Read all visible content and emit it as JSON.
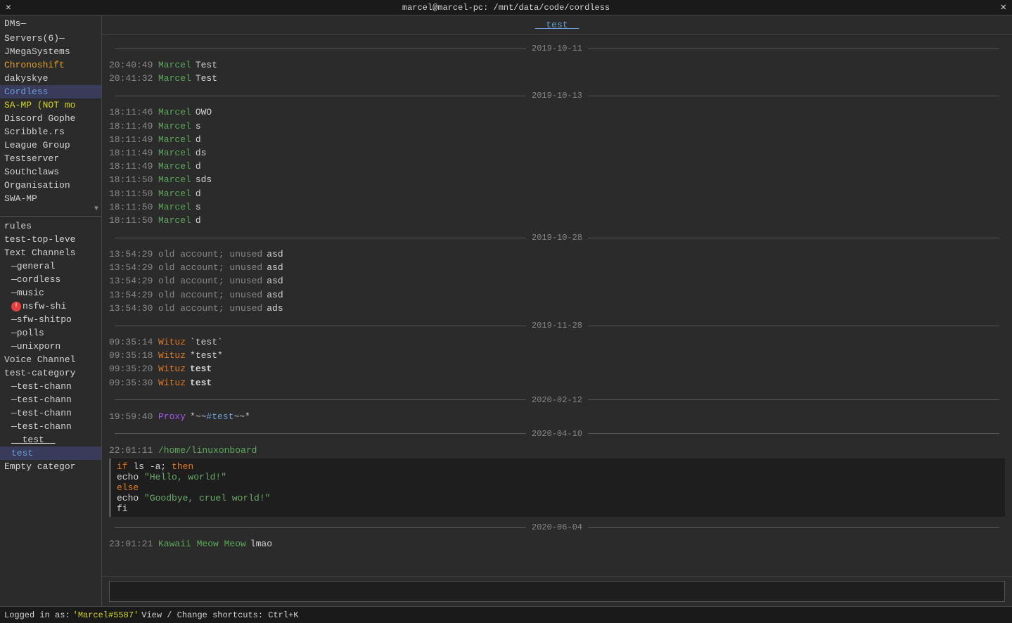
{
  "titlebar": {
    "title": "marcel@marcel-pc: /mnt/data/code/cordless",
    "close_label": "✕",
    "x_label": "✕"
  },
  "sidebar": {
    "dms_label": "DMs—",
    "servers_label": "Servers(6)—",
    "servers": [
      {
        "name": "JMegaSystems",
        "color": "normal"
      },
      {
        "name": "Chronoshift",
        "color": "orange"
      },
      {
        "name": "dakyskye",
        "color": "normal"
      },
      {
        "name": "Cordless",
        "color": "cordless"
      },
      {
        "name": "SA-MP (NOT mo",
        "color": "yellow"
      },
      {
        "name": "Discord Gophe",
        "color": "normal"
      },
      {
        "name": "Scribble.rs",
        "color": "normal"
      },
      {
        "name": "League Group",
        "color": "normal"
      },
      {
        "name": "Testserver",
        "color": "normal"
      },
      {
        "name": "Southclaws",
        "color": "normal"
      },
      {
        "name": "Organisation",
        "color": "normal"
      },
      {
        "name": "SWA-MP",
        "color": "normal"
      }
    ],
    "channels_header": "rules",
    "channels": [
      {
        "name": "rules",
        "indent": 0,
        "type": "text",
        "active": false
      },
      {
        "name": "test-top-leve",
        "indent": 0,
        "type": "text",
        "active": false
      },
      {
        "name": "Text Channels",
        "indent": 0,
        "type": "category",
        "active": false
      },
      {
        "name": "—general",
        "indent": 1,
        "type": "channel",
        "active": false
      },
      {
        "name": "—cordless",
        "indent": 1,
        "type": "channel",
        "active": false
      },
      {
        "name": "—music",
        "indent": 1,
        "type": "channel",
        "active": false
      },
      {
        "name": "—nsfw-shi",
        "indent": 1,
        "type": "channel",
        "notification": true,
        "active": false
      },
      {
        "name": "—sfw-shitpo",
        "indent": 1,
        "type": "channel",
        "active": false
      },
      {
        "name": "—polls",
        "indent": 1,
        "type": "channel",
        "active": false
      },
      {
        "name": "—unixporn",
        "indent": 1,
        "type": "channel",
        "active": false
      },
      {
        "name": "Voice Channel",
        "indent": 0,
        "type": "category",
        "active": false
      },
      {
        "name": "test-category",
        "indent": 0,
        "type": "category",
        "active": false
      },
      {
        "name": "—test-chann",
        "indent": 1,
        "type": "channel",
        "active": false
      },
      {
        "name": "—test-chann",
        "indent": 1,
        "type": "channel",
        "active": false
      },
      {
        "name": "—test-chann",
        "indent": 1,
        "type": "channel",
        "active": false
      },
      {
        "name": "—test-chann",
        "indent": 1,
        "type": "channel",
        "active": false
      },
      {
        "name": "__test__",
        "indent": 1,
        "type": "channel",
        "active": false
      },
      {
        "name": "test",
        "indent": 1,
        "type": "channel",
        "active": true
      },
      {
        "name": "Empty categor",
        "indent": 0,
        "type": "category",
        "active": false
      }
    ]
  },
  "channel": {
    "title": "__test__"
  },
  "messages": [
    {
      "type": "date_separator",
      "date": "2019-10-11"
    },
    {
      "type": "message",
      "time": "20:40:49",
      "author": "Marcel",
      "author_class": "author-marcel",
      "content": "Test"
    },
    {
      "type": "message",
      "time": "20:41:32",
      "author": "Marcel",
      "author_class": "author-marcel",
      "content": "Test"
    },
    {
      "type": "date_separator",
      "date": "2019-10-13"
    },
    {
      "type": "message",
      "time": "18:11:46",
      "author": "Marcel",
      "author_class": "author-marcel",
      "content": "OWO"
    },
    {
      "type": "message",
      "time": "18:11:49",
      "author": "Marcel",
      "author_class": "author-marcel",
      "content": "s"
    },
    {
      "type": "message",
      "time": "18:11:49",
      "author": "Marcel",
      "author_class": "author-marcel",
      "content": "d"
    },
    {
      "type": "message",
      "time": "18:11:49",
      "author": "Marcel",
      "author_class": "author-marcel",
      "content": "ds"
    },
    {
      "type": "message",
      "time": "18:11:49",
      "author": "Marcel",
      "author_class": "author-marcel",
      "content": "d"
    },
    {
      "type": "message",
      "time": "18:11:50",
      "author": "Marcel",
      "author_class": "author-marcel",
      "content": "sds"
    },
    {
      "type": "message",
      "time": "18:11:50",
      "author": "Marcel",
      "author_class": "author-marcel",
      "content": "d"
    },
    {
      "type": "message",
      "time": "18:11:50",
      "author": "Marcel",
      "author_class": "author-marcel",
      "content": "s"
    },
    {
      "type": "message",
      "time": "18:11:50",
      "author": "Marcel",
      "author_class": "author-marcel",
      "content": "d"
    },
    {
      "type": "date_separator",
      "date": "2019-10-28"
    },
    {
      "type": "message",
      "time": "13:54:29",
      "author": "old account; unused",
      "author_class": "author-old",
      "content": "asd"
    },
    {
      "type": "message",
      "time": "13:54:29",
      "author": "old account; unused",
      "author_class": "author-old",
      "content": "asd"
    },
    {
      "type": "message",
      "time": "13:54:29",
      "author": "old account; unused",
      "author_class": "author-old",
      "content": "asd"
    },
    {
      "type": "message",
      "time": "13:54:29",
      "author": "old account; unused",
      "author_class": "author-old",
      "content": "asd"
    },
    {
      "type": "message",
      "time": "13:54:30",
      "author": "old account; unused",
      "author_class": "author-old",
      "content": "ads"
    },
    {
      "type": "date_separator",
      "date": "2019-11-28"
    },
    {
      "type": "message",
      "time": "09:35:14",
      "author": "Wituz",
      "author_class": "author-wituz",
      "content": "`test`",
      "formatted": "backtick"
    },
    {
      "type": "message",
      "time": "09:35:18",
      "author": "Wituz",
      "author_class": "author-wituz",
      "content": "*test*",
      "formatted": "italic"
    },
    {
      "type": "message",
      "time": "09:35:20",
      "author": "Wituz",
      "author_class": "author-wituz",
      "content": "test",
      "formatted": "bold"
    },
    {
      "type": "message",
      "time": "09:35:30",
      "author": "Wituz",
      "author_class": "author-wituz",
      "content": "test",
      "formatted": "bold"
    },
    {
      "type": "date_separator",
      "date": "2020-02-12"
    },
    {
      "type": "message",
      "time": "19:59:40",
      "author": "Proxy",
      "author_class": "author-proxy",
      "content": "*~~#test~~*",
      "formatted": "special"
    },
    {
      "type": "date_separator",
      "date": "2020-04-10"
    },
    {
      "type": "message_code",
      "time": "22:01:11",
      "author": "/home/linuxonboard",
      "author_class": "author-linuxonboard",
      "code_lines": [
        "if ls -a; then",
        "echo \"Hello, world!\"",
        "else",
        "echo \"Goodbye, cruel world!\"",
        "fi"
      ]
    },
    {
      "type": "date_separator",
      "date": "2020-06-04"
    },
    {
      "type": "message",
      "time": "23:01:21",
      "author": "Kawaii Meow Meow",
      "author_class": "author-kawaii",
      "content": "lmao"
    }
  ],
  "input": {
    "placeholder": ""
  },
  "status": {
    "logged_in_label": "Logged in as:",
    "username": "'Marcel#5587'",
    "shortcuts_label": "View / Change shortcuts: Ctrl+K"
  }
}
